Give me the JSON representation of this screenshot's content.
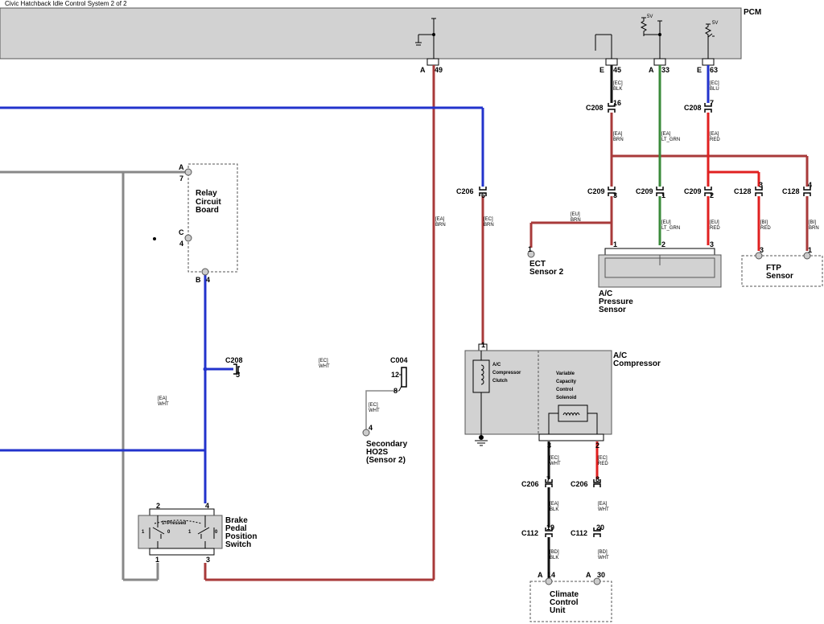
{
  "title": "Civic Hatchback Idle Control System 2 of 2",
  "pcm": {
    "label": "PCM",
    "v5_left": "5V",
    "v5_right": "5V",
    "pins": [
      {
        "letter": "A",
        "num": "49"
      },
      {
        "letter": "E",
        "num": "45"
      },
      {
        "letter": "A",
        "num": "33"
      },
      {
        "letter": "E",
        "num": "63"
      }
    ]
  },
  "colors": {
    "brn": "#a83a3a",
    "blu": "#2233cc",
    "blk": "#111111",
    "red": "#e02020",
    "lt_grn": "#3a8a3a",
    "wht": "#888888",
    "box": "#d2d2d2"
  },
  "wire_labels": [
    {
      "id": "w1a",
      "l1": "[EC]",
      "l2": "BLK"
    },
    {
      "id": "w1b",
      "l1": "[EA]",
      "l2": "BRN"
    },
    {
      "id": "w2a",
      "l1": "[EA]",
      "l2": "LT_GRN"
    },
    {
      "id": "w3a",
      "l1": "[EC]",
      "l2": "BLU"
    },
    {
      "id": "w3b",
      "l1": "[EA]",
      "l2": "RED"
    },
    {
      "id": "w4a",
      "l1": "[EU]",
      "l2": "BRN"
    },
    {
      "id": "w5a",
      "l1": "[EU]",
      "l2": "LT_GRN"
    },
    {
      "id": "w6a",
      "l1": "[EU]",
      "l2": "RED"
    },
    {
      "id": "w7a",
      "l1": "[BI]",
      "l2": "RED"
    },
    {
      "id": "w8a",
      "l1": "[BI]",
      "l2": "BRN"
    },
    {
      "id": "w9a",
      "l1": "[EA]",
      "l2": "BRN"
    },
    {
      "id": "w10a",
      "l1": "[EC]",
      "l2": "BRN"
    },
    {
      "id": "w11a",
      "l1": "[EC]",
      "l2": "WHT"
    },
    {
      "id": "w12a",
      "l1": "[EC]",
      "l2": "WHT"
    },
    {
      "id": "w13a",
      "l1": "[EA]",
      "l2": "WHT"
    },
    {
      "id": "w14a",
      "l1": "[EC]",
      "l2": "WHT"
    },
    {
      "id": "w15a",
      "l1": "[EC]",
      "l2": "RED"
    },
    {
      "id": "w16a",
      "l1": "[EA]",
      "l2": "BLK"
    },
    {
      "id": "w17a",
      "l1": "[EA]",
      "l2": "WHT"
    },
    {
      "id": "w18a",
      "l1": "[BD]",
      "l2": "BLK"
    },
    {
      "id": "w19a",
      "l1": "[BD]",
      "l2": "WHT"
    }
  ],
  "connectors": [
    {
      "id": "c208a",
      "name": "C208",
      "pin": "16"
    },
    {
      "id": "c208b",
      "name": "C208",
      "pin": "7"
    },
    {
      "id": "c209a",
      "name": "C209",
      "pin": "3"
    },
    {
      "id": "c209b",
      "name": "C209",
      "pin": "1"
    },
    {
      "id": "c209c",
      "name": "C209",
      "pin": "2"
    },
    {
      "id": "c128a",
      "name": "C128",
      "pin": "3"
    },
    {
      "id": "c128b",
      "name": "C128",
      "pin": "4"
    },
    {
      "id": "c206a",
      "name": "C206",
      "pin": "6"
    },
    {
      "id": "c208c",
      "name": "C208",
      "pin": "5"
    },
    {
      "id": "c004",
      "name": "C004",
      "pin": "12",
      "pin2": "8"
    },
    {
      "id": "c206b",
      "name": "C206",
      "pin": "7"
    },
    {
      "id": "c206c",
      "name": "C206",
      "pin": "8"
    },
    {
      "id": "c112a",
      "name": "C112",
      "pin": "19"
    },
    {
      "id": "c112b",
      "name": "C112",
      "pin": "20"
    }
  ],
  "relay": {
    "l1": "Relay",
    "l2": "Circuit",
    "l3": "Board",
    "pinA": "A",
    "pinA_n": "7",
    "pinC": "C",
    "pinC_n": "4",
    "pinB": "B",
    "pinB_n": "4"
  },
  "ect": {
    "l1": "ECT",
    "l2": "Sensor 2",
    "pin": "1"
  },
  "acp": {
    "l1": "A/C",
    "l2": "Pressure",
    "l3": "Sensor",
    "p1": "1",
    "p2": "2",
    "p3": "3"
  },
  "ftp": {
    "l1": "FTP",
    "l2": "Sensor",
    "p1": "3",
    "p2": "1"
  },
  "compressor": {
    "l1": "A/C",
    "l2": "Compressor",
    "pin_top": "1",
    "clutch1": "A/C",
    "clutch2": "Compressor",
    "clutch3": "Clutch",
    "sol1": "Variable",
    "sol2": "Capacity",
    "sol3": "Control",
    "sol4": "Solenoid",
    "p3": "3",
    "p2": "2"
  },
  "ho2s": {
    "l1": "Secondary",
    "l2": "HO2S",
    "l3": "(Sensor 2)",
    "pin": "4"
  },
  "brake": {
    "l1": "Brake",
    "l2": "Pedal",
    "l3": "Position",
    "l4": "Switch",
    "pressed": "1=Pressed",
    "p2": "2",
    "p4": "4",
    "p1": "1",
    "p3": "3",
    "sw_l1": "1",
    "sw_l0": "0",
    "sw_r1": "1",
    "sw_r0": "0"
  },
  "ccu": {
    "l1": "Climate",
    "l2": "Control",
    "l3": "Unit",
    "pinA1": "A",
    "pin14": "14",
    "pinA2": "A",
    "pin30": "30"
  }
}
